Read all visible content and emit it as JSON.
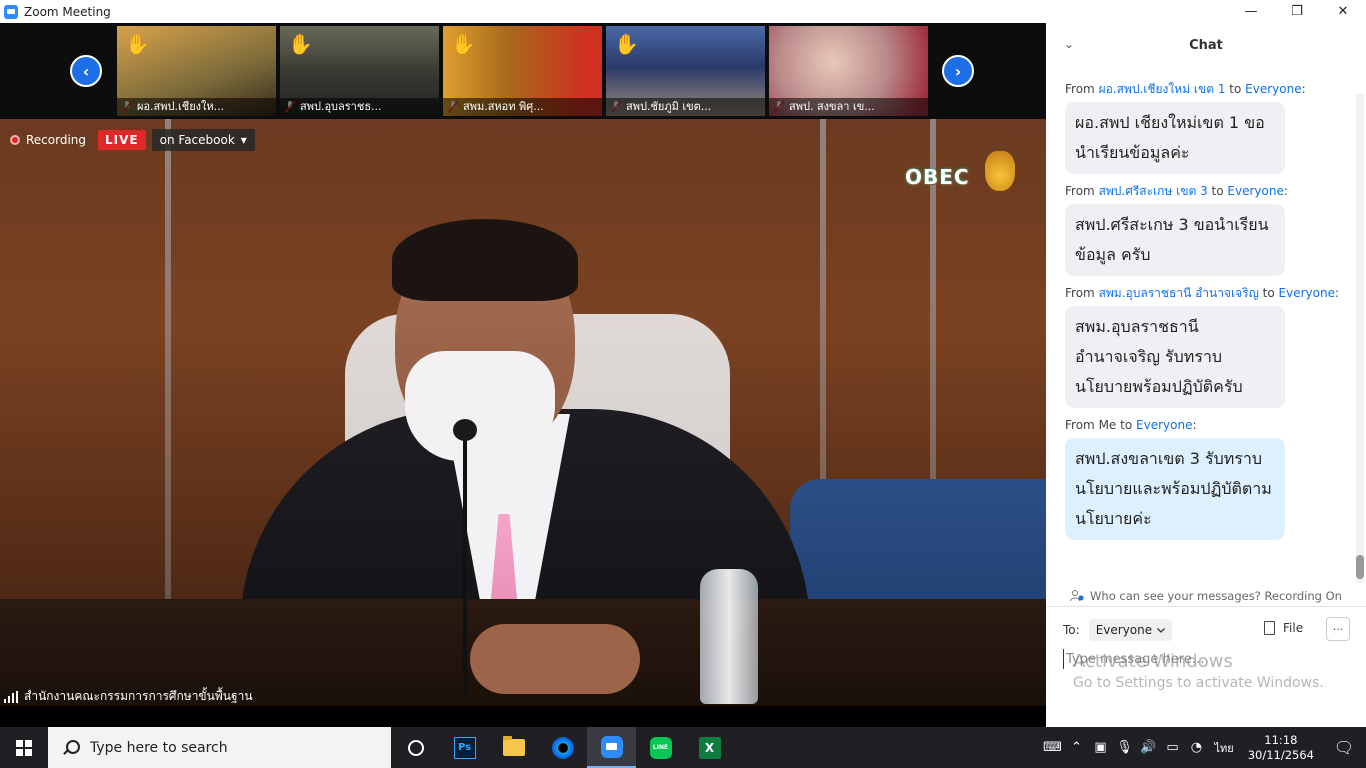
{
  "window": {
    "title": "Zoom Meeting",
    "minimize": "—",
    "restore": "❐",
    "close": "✕"
  },
  "thumbnails": [
    {
      "name": "ผอ.สพป.เชียงให...",
      "raised_hand": true,
      "bg": "#7a6a3a"
    },
    {
      "name": "สพป.อุบลราชธ...",
      "raised_hand": true,
      "bg": "#3a3a33"
    },
    {
      "name": "สพม.สหอท พิศุ...",
      "raised_hand": true,
      "bg": "#a86a1a"
    },
    {
      "name": "สพป.ชัยภูมิ เขต...",
      "raised_hand": true,
      "bg": "#2a3a6a"
    },
    {
      "name": "สพป. สงขลา เข...",
      "raised_hand": false,
      "bg": "#b88a8a"
    }
  ],
  "nav": {
    "prev": "‹",
    "next": "›"
  },
  "recording": {
    "label": "Recording",
    "live": "LIVE",
    "stream_target": "on Facebook",
    "dropdown": "▾"
  },
  "logo": {
    "text": "OBEC"
  },
  "main_video": {
    "participant": "สำนักงานคณะกรรมการการศึกษาขั้นพื้นฐาน"
  },
  "chat": {
    "title": "Chat",
    "collapse": "⌄",
    "messages": [
      {
        "from": "ผอ.สพป.เชียงใหม่ เขต 1",
        "to": "Everyone",
        "text": "ผอ.สพป เชียงใหม่เขต 1 ขอนำเรียนข้อมูลค่ะ",
        "mine": false
      },
      {
        "from": "สพป.ศรีสะเกษ เขต 3",
        "to": "Everyone",
        "text": "สพป.ศรีสะเกษ 3 ขอนำเรียนข้อมูล ครับ",
        "mine": false
      },
      {
        "from": "สพม.อุบลราชธานี อำนาจเจริญ",
        "to": "Everyone",
        "text": "สพม.อุบลราชธานี อำนาจเจริญ รับทราบนโยบายพร้อมปฏิบัติครับ",
        "mine": false
      },
      {
        "from": "Me",
        "to": "Everyone",
        "text": "สพป.สงขลาเขต 3 รับทราบนโยบายและพร้อมปฏิบัติตามนโยบายค่ะ",
        "mine": true
      }
    ],
    "from_prefix": "From",
    "to_word": "to",
    "privacy_note": "Who can see your messages? Recording On",
    "to_label": "To:",
    "to_value": "Everyone",
    "file_label": "File",
    "more_label": "···",
    "input_placeholder": "Type message here..."
  },
  "watermark": {
    "line1": "Activate Windows",
    "line2": "Go to Settings to activate Windows."
  },
  "taskbar": {
    "search_placeholder": "Type here to search",
    "ps_label": "Ps",
    "line_label": "LINE",
    "excel_label": "X",
    "lang": "ไทย",
    "time": "11:18",
    "date": "30/11/2564"
  }
}
